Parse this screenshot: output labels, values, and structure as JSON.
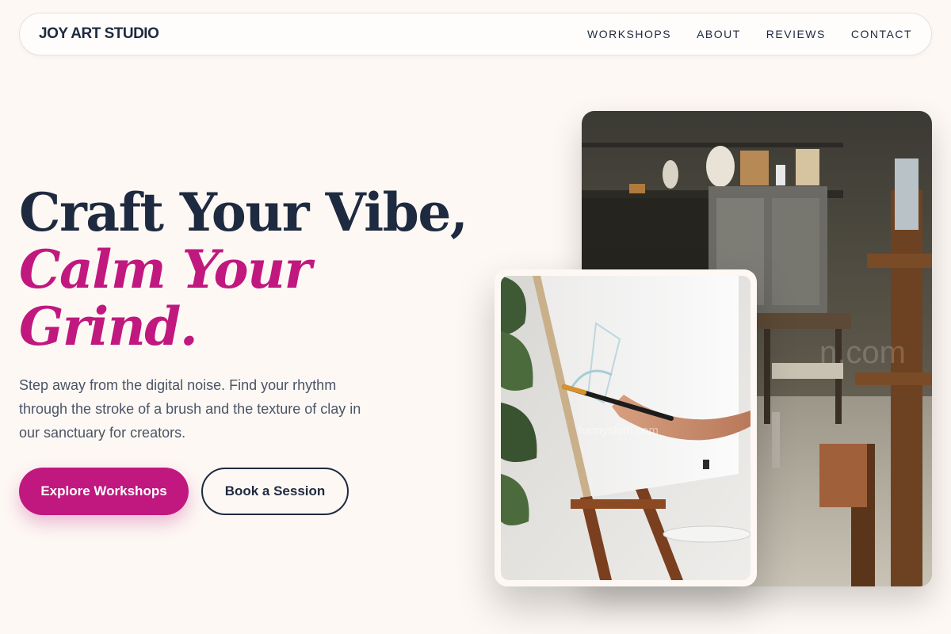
{
  "brand": {
    "name": "JOY ART STUDIO"
  },
  "nav": {
    "items": [
      {
        "label": "WORKSHOPS"
      },
      {
        "label": "ABOUT"
      },
      {
        "label": "REVIEWS"
      },
      {
        "label": "CONTACT"
      }
    ]
  },
  "hero": {
    "headline_line1": "Craft Your Vibe,",
    "headline_line2": "Calm Your",
    "headline_line3": "Grind.",
    "description": "Step away from the digital noise. Find your rhythm through the stroke of a brush and the texture of clay in our sanctuary for creators.",
    "primary_cta": "Explore Workshops",
    "secondary_cta": "Book a Session"
  },
  "images": {
    "studio": "art-studio-interior-photo",
    "painter": "painter-at-easel-photo"
  },
  "colors": {
    "background": "#fdf8f4",
    "ink": "#1e2a3f",
    "accent": "#c0187f",
    "muted_text": "#4a5567"
  }
}
